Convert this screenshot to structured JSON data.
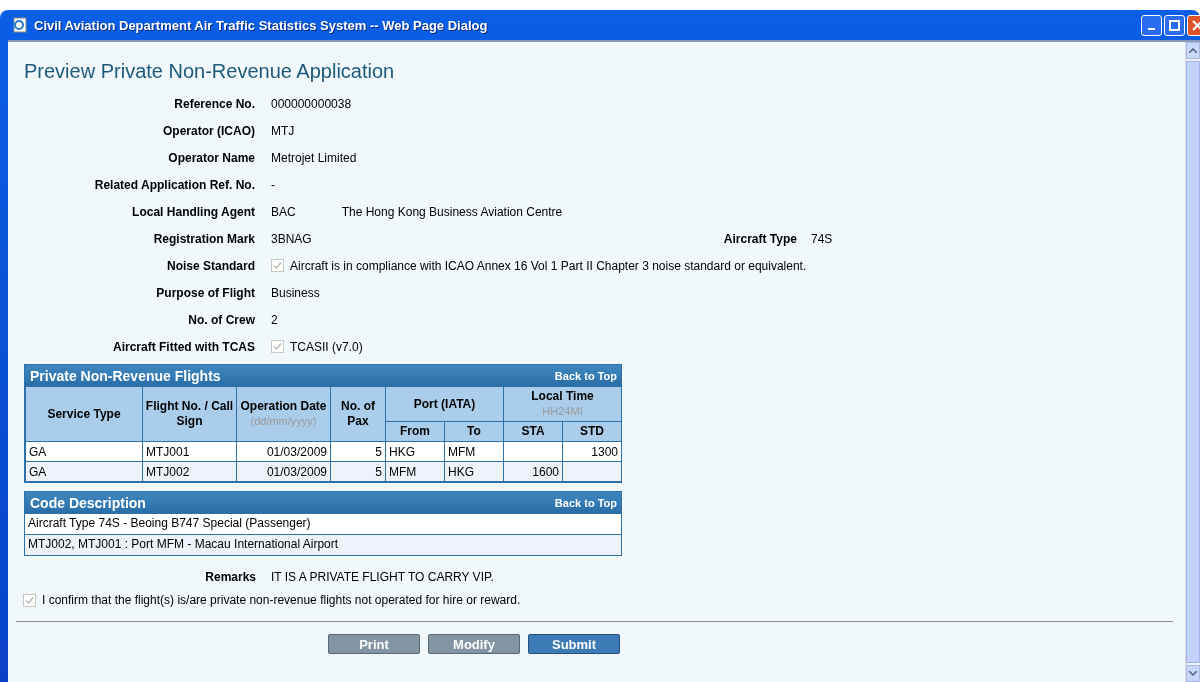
{
  "window": {
    "title": "Civil Aviation Department Air Traffic Statistics System -- Web Page Dialog"
  },
  "heading": "Preview Private Non-Revenue Application",
  "fields": [
    {
      "kind": "text",
      "label": "Reference No.",
      "value": "000000000038"
    },
    {
      "kind": "text",
      "label": "Operator (ICAO)",
      "value": "MTJ"
    },
    {
      "kind": "text",
      "label": "Operator Name",
      "value": "Metrojet Limited"
    },
    {
      "kind": "text",
      "label": "Related Application Ref. No.",
      "value": "-"
    },
    {
      "kind": "pair",
      "label": "Local Handling Agent",
      "value": "BAC",
      "value_2": "The Hong Kong Business Aviation Centre"
    },
    {
      "kind": "split",
      "label": "Registration Mark",
      "value": "3BNAG",
      "side_label": "Aircraft Type",
      "side_value": "74S"
    },
    {
      "kind": "check",
      "label": "Noise Standard",
      "checked": true,
      "value": "Aircraft is in compliance with ICAO Annex 16 Vol 1 Part II Chapter 3 noise standard or equivalent."
    },
    {
      "kind": "text",
      "label": "Purpose of Flight",
      "value": "Business"
    },
    {
      "kind": "text",
      "label": "No. of Crew",
      "value": "2"
    },
    {
      "kind": "check",
      "label": "Aircraft Fitted with TCAS",
      "checked": true,
      "value": "TCASII (v7.0)"
    }
  ],
  "flights": {
    "title": "Private Non-Revenue Flights",
    "back_link": "Back to Top",
    "columns": [
      {
        "label": "Service Type"
      },
      {
        "label": "Flight No. / Call Sign"
      },
      {
        "label": "Operation Date",
        "hint": "(dd/mm/yyyy)"
      },
      {
        "label": "No. of Pax"
      },
      {
        "label": "Port (IATA)",
        "colspan": 2,
        "children": [
          "From",
          "To"
        ]
      },
      {
        "label": "Local Time",
        "hint": "HH24MI",
        "colspan": 2,
        "children": [
          "STA",
          "STD"
        ]
      }
    ],
    "rows": [
      [
        "GA",
        "MTJ001",
        "01/03/2009",
        "5",
        "HKG",
        "MFM",
        "",
        "1300"
      ],
      [
        "GA",
        "MTJ002",
        "01/03/2009",
        "5",
        "MFM",
        "HKG",
        "1600",
        ""
      ]
    ]
  },
  "codes": {
    "title": "Code Description",
    "back_link": "Back to Top",
    "rows": [
      "Aircraft Type 74S - Beoing B747 Special (Passenger)",
      "MTJ002, MTJ001 : Port MFM - Macau International Airport"
    ]
  },
  "remarks": {
    "label": "Remarks",
    "value": "IT IS A PRIVATE FLIGHT TO CARRY VIP."
  },
  "confirm": {
    "checked": true,
    "text": "I confirm that the flight(s) is/are private non-revenue flights not operated for hire or reward."
  },
  "buttons": [
    {
      "label": "Print",
      "kind": "secondary"
    },
    {
      "label": "Modify",
      "kind": "secondary"
    },
    {
      "label": "Submit",
      "kind": "primary"
    }
  ]
}
